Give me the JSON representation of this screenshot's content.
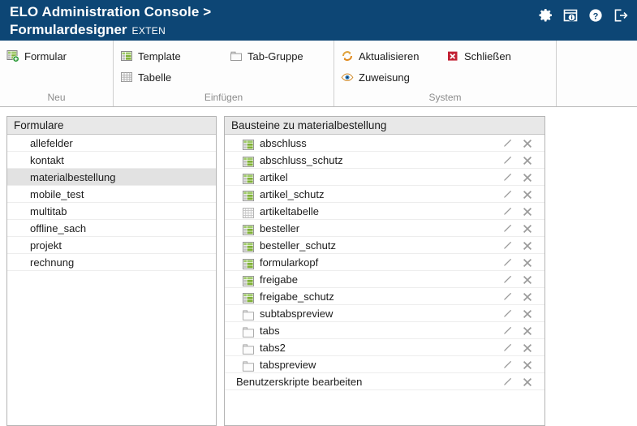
{
  "titlebar": {
    "app_title": "ELO Administration Console >",
    "module_title": "Formulardesigner",
    "module_suffix": "EXTEN",
    "bg_color": "#0d4675",
    "icons": [
      {
        "name": "gear-icon",
        "label": "Einstellungen"
      },
      {
        "name": "info-window-icon",
        "label": "Info"
      },
      {
        "name": "help-icon",
        "label": "Hilfe"
      },
      {
        "name": "logout-icon",
        "label": "Abmelden"
      }
    ]
  },
  "ribbon": {
    "groups": [
      {
        "label": "Neu",
        "columns": [
          {
            "items": [
              {
                "label": "Formular",
                "icon": "new-form-icon"
              }
            ]
          }
        ]
      },
      {
        "label": "Einfügen",
        "columns": [
          {
            "items": [
              {
                "label": "Template",
                "icon": "template-icon"
              },
              {
                "label": "Tabelle",
                "icon": "table-icon"
              }
            ]
          },
          {
            "items": [
              {
                "label": "Tab-Gruppe",
                "icon": "tabgroup-icon"
              }
            ]
          }
        ]
      },
      {
        "label": "System",
        "columns": [
          {
            "items": [
              {
                "label": "Aktualisieren",
                "icon": "refresh-icon"
              },
              {
                "label": "Zuweisung",
                "icon": "eye-icon"
              }
            ]
          },
          {
            "items": [
              {
                "label": "Schließen",
                "icon": "close-red-icon"
              }
            ]
          }
        ]
      }
    ]
  },
  "panels": {
    "formulare": {
      "header": "Formulare",
      "selected": "materialbestellung",
      "items": [
        {
          "label": "allefelder"
        },
        {
          "label": "kontakt"
        },
        {
          "label": "materialbestellung"
        },
        {
          "label": "mobile_test"
        },
        {
          "label": "multitab"
        },
        {
          "label": "offline_sach"
        },
        {
          "label": "projekt"
        },
        {
          "label": "rechnung"
        }
      ]
    },
    "bausteine": {
      "header": "Bausteine zu materialbestellung",
      "row_actions": [
        {
          "name": "edit-pencil-icon"
        },
        {
          "name": "delete-x-icon"
        }
      ],
      "items": [
        {
          "label": "abschluss",
          "icon": "template-icon"
        },
        {
          "label": "abschluss_schutz",
          "icon": "template-icon"
        },
        {
          "label": "artikel",
          "icon": "template-icon"
        },
        {
          "label": "artikel_schutz",
          "icon": "template-icon"
        },
        {
          "label": "artikeltabelle",
          "icon": "table-icon"
        },
        {
          "label": "besteller",
          "icon": "template-icon"
        },
        {
          "label": "besteller_schutz",
          "icon": "template-icon"
        },
        {
          "label": "formularkopf",
          "icon": "template-icon"
        },
        {
          "label": "freigabe",
          "icon": "template-icon"
        },
        {
          "label": "freigabe_schutz",
          "icon": "template-icon"
        },
        {
          "label": "subtabspreview",
          "icon": "tabgroup-icon"
        },
        {
          "label": "tabs",
          "icon": "tabgroup-icon"
        },
        {
          "label": "tabs2",
          "icon": "tabgroup-icon"
        },
        {
          "label": "tabspreview",
          "icon": "tabgroup-icon"
        },
        {
          "label": "Benutzerskripte bearbeiten",
          "icon": "none"
        }
      ]
    }
  },
  "colors": {
    "header_blue": "#0d4675",
    "panel_header_gray": "#e8e8e8",
    "selection_gray": "#e2e2e2",
    "template_green": "#7fb036",
    "close_red": "#c22033",
    "refresh_orange": "#e08a1e"
  }
}
